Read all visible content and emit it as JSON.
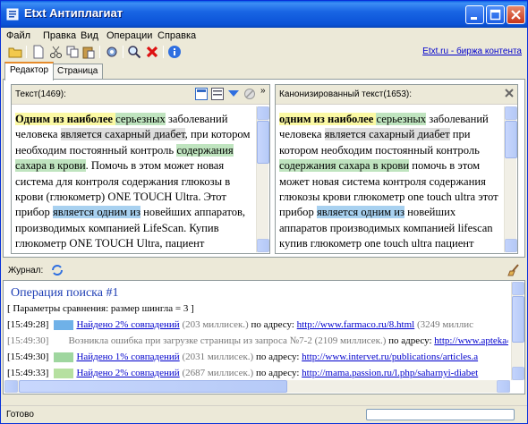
{
  "window": {
    "title": "Etxt Антиплагиат"
  },
  "menu": [
    "Файл",
    "Правка",
    "Вид",
    "Операции",
    "Справка"
  ],
  "toolbar": {
    "link": "Etxt.ru - биржа контента",
    "icons": [
      "open-folder-icon",
      "new-doc-icon",
      "cut-icon",
      "copy-icon",
      "paste-icon",
      "settings-icon",
      "search-icon",
      "stop-icon",
      "info-icon"
    ]
  },
  "tabs": [
    "Редактор",
    "Страница"
  ],
  "left_pane": {
    "title": "Текст(1469):",
    "segments": [
      {
        "t": "Одним из наиболее ",
        "c": "hl-yellow bold"
      },
      {
        "t": "серьезных",
        "c": "hl-green"
      },
      {
        "t": " заболеваний человека ",
        "c": ""
      },
      {
        "t": "является сахарный диабет",
        "c": "hl-gray"
      },
      {
        "t": ", при котором необходим постоянный контроль ",
        "c": ""
      },
      {
        "t": "содержания сахара в крови",
        "c": "hl-green"
      },
      {
        "t": ". Помочь в этом может новая система для контроля содержания глюкозы в крови (глюкометр) ONE TOUCH Ultra. Этот прибор ",
        "c": ""
      },
      {
        "t": "является одним из",
        "c": "hl-blue"
      },
      {
        "t": " новейших аппаратов, производимых компанией LifeScan. Купив глюкометр ONE TOUCH Ultra, пациент",
        "c": ""
      }
    ]
  },
  "right_pane": {
    "title": "Канонизированный текст(1653):",
    "segments": [
      {
        "t": "одним из наиболее ",
        "c": "hl-yellow bold"
      },
      {
        "t": "серьезных",
        "c": "hl-green"
      },
      {
        "t": " заболеваний человека ",
        "c": ""
      },
      {
        "t": "является сахарный диабет",
        "c": "hl-gray"
      },
      {
        "t": " при котором необходим постоянный контроль ",
        "c": ""
      },
      {
        "t": "содержания сахара в крови",
        "c": "hl-green"
      },
      {
        "t": " помочь в этом может новая система контроля содержания глюкозы крови глюкометр one touch ultra этот прибор ",
        "c": ""
      },
      {
        "t": "является одним из",
        "c": "hl-blue"
      },
      {
        "t": " новейших аппаратов производимых компанией lifescan купив глюкометр one touch ultra пациент может",
        "c": ""
      }
    ]
  },
  "journal": {
    "label": "Журнал:",
    "operation_title": "Операция поиска #1",
    "params": "[ Параметры сравнения: размер шингла = 3 ]",
    "entries": [
      {
        "time": "[15:49:28]",
        "swatch": "#6fb1e8",
        "link": "Найдено 2% совпадений",
        "ms": " (203 миллисек.)",
        "at": " по адресу: ",
        "url": "http://www.farmaco.ru/8.html",
        "tail": " (3249 миллис",
        "error": false
      },
      {
        "time": "[15:49:30]",
        "swatch": "",
        "link": "",
        "ms": "Возникла ошибка при загрузке страницы из запроса №7-2 (2109 миллисек.)",
        "at": " по адресу: ",
        "url": "http://www.apteka4",
        "tail": "",
        "error": true
      },
      {
        "time": "[15:49:30]",
        "swatch": "#9fd69f",
        "link": "Найдено 1% совпадений",
        "ms": " (2031 миллисек.)",
        "at": " по адресу: ",
        "url": "http://www.intervet.ru/publications/articles.a",
        "tail": "",
        "error": false
      },
      {
        "time": "[15:49:33]",
        "swatch": "#b6e0a0",
        "link": "Найдено 2% совпадений",
        "ms": " (2687 миллисек.)",
        "at": " по адресу: ",
        "url": "http://mama.passion.ru/l.php/saharnyi-diabet",
        "tail": "",
        "error": false
      }
    ]
  },
  "status": {
    "text": "Готово"
  }
}
